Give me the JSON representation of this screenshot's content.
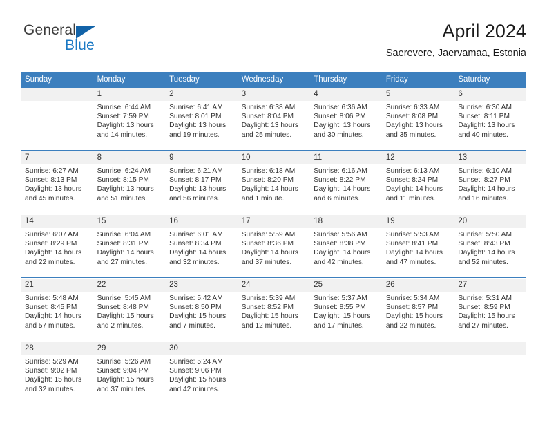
{
  "brand": {
    "name_part1": "General",
    "name_part2": "Blue",
    "accent_color": "#1b79c4",
    "triangle_color": "#1263a8"
  },
  "header": {
    "title": "April 2024",
    "subtitle": "Saerevere, Jaervamaa, Estonia"
  },
  "theme": {
    "header_row_bg": "#3c7fbe",
    "daynum_bg": "#f1f1f1",
    "separator_color": "#3c7fbe",
    "text_color": "#333333"
  },
  "weekdays": [
    "Sunday",
    "Monday",
    "Tuesday",
    "Wednesday",
    "Thursday",
    "Friday",
    "Saturday"
  ],
  "weeks": [
    {
      "days": [
        {
          "num": "",
          "sunrise": "",
          "sunset": "",
          "daylight": ""
        },
        {
          "num": "1",
          "sunrise": "Sunrise: 6:44 AM",
          "sunset": "Sunset: 7:59 PM",
          "daylight": "Daylight: 13 hours and 14 minutes."
        },
        {
          "num": "2",
          "sunrise": "Sunrise: 6:41 AM",
          "sunset": "Sunset: 8:01 PM",
          "daylight": "Daylight: 13 hours and 19 minutes."
        },
        {
          "num": "3",
          "sunrise": "Sunrise: 6:38 AM",
          "sunset": "Sunset: 8:04 PM",
          "daylight": "Daylight: 13 hours and 25 minutes."
        },
        {
          "num": "4",
          "sunrise": "Sunrise: 6:36 AM",
          "sunset": "Sunset: 8:06 PM",
          "daylight": "Daylight: 13 hours and 30 minutes."
        },
        {
          "num": "5",
          "sunrise": "Sunrise: 6:33 AM",
          "sunset": "Sunset: 8:08 PM",
          "daylight": "Daylight: 13 hours and 35 minutes."
        },
        {
          "num": "6",
          "sunrise": "Sunrise: 6:30 AM",
          "sunset": "Sunset: 8:11 PM",
          "daylight": "Daylight: 13 hours and 40 minutes."
        }
      ]
    },
    {
      "days": [
        {
          "num": "7",
          "sunrise": "Sunrise: 6:27 AM",
          "sunset": "Sunset: 8:13 PM",
          "daylight": "Daylight: 13 hours and 45 minutes."
        },
        {
          "num": "8",
          "sunrise": "Sunrise: 6:24 AM",
          "sunset": "Sunset: 8:15 PM",
          "daylight": "Daylight: 13 hours and 51 minutes."
        },
        {
          "num": "9",
          "sunrise": "Sunrise: 6:21 AM",
          "sunset": "Sunset: 8:17 PM",
          "daylight": "Daylight: 13 hours and 56 minutes."
        },
        {
          "num": "10",
          "sunrise": "Sunrise: 6:18 AM",
          "sunset": "Sunset: 8:20 PM",
          "daylight": "Daylight: 14 hours and 1 minute."
        },
        {
          "num": "11",
          "sunrise": "Sunrise: 6:16 AM",
          "sunset": "Sunset: 8:22 PM",
          "daylight": "Daylight: 14 hours and 6 minutes."
        },
        {
          "num": "12",
          "sunrise": "Sunrise: 6:13 AM",
          "sunset": "Sunset: 8:24 PM",
          "daylight": "Daylight: 14 hours and 11 minutes."
        },
        {
          "num": "13",
          "sunrise": "Sunrise: 6:10 AM",
          "sunset": "Sunset: 8:27 PM",
          "daylight": "Daylight: 14 hours and 16 minutes."
        }
      ]
    },
    {
      "days": [
        {
          "num": "14",
          "sunrise": "Sunrise: 6:07 AM",
          "sunset": "Sunset: 8:29 PM",
          "daylight": "Daylight: 14 hours and 22 minutes."
        },
        {
          "num": "15",
          "sunrise": "Sunrise: 6:04 AM",
          "sunset": "Sunset: 8:31 PM",
          "daylight": "Daylight: 14 hours and 27 minutes."
        },
        {
          "num": "16",
          "sunrise": "Sunrise: 6:01 AM",
          "sunset": "Sunset: 8:34 PM",
          "daylight": "Daylight: 14 hours and 32 minutes."
        },
        {
          "num": "17",
          "sunrise": "Sunrise: 5:59 AM",
          "sunset": "Sunset: 8:36 PM",
          "daylight": "Daylight: 14 hours and 37 minutes."
        },
        {
          "num": "18",
          "sunrise": "Sunrise: 5:56 AM",
          "sunset": "Sunset: 8:38 PM",
          "daylight": "Daylight: 14 hours and 42 minutes."
        },
        {
          "num": "19",
          "sunrise": "Sunrise: 5:53 AM",
          "sunset": "Sunset: 8:41 PM",
          "daylight": "Daylight: 14 hours and 47 minutes."
        },
        {
          "num": "20",
          "sunrise": "Sunrise: 5:50 AM",
          "sunset": "Sunset: 8:43 PM",
          "daylight": "Daylight: 14 hours and 52 minutes."
        }
      ]
    },
    {
      "days": [
        {
          "num": "21",
          "sunrise": "Sunrise: 5:48 AM",
          "sunset": "Sunset: 8:45 PM",
          "daylight": "Daylight: 14 hours and 57 minutes."
        },
        {
          "num": "22",
          "sunrise": "Sunrise: 5:45 AM",
          "sunset": "Sunset: 8:48 PM",
          "daylight": "Daylight: 15 hours and 2 minutes."
        },
        {
          "num": "23",
          "sunrise": "Sunrise: 5:42 AM",
          "sunset": "Sunset: 8:50 PM",
          "daylight": "Daylight: 15 hours and 7 minutes."
        },
        {
          "num": "24",
          "sunrise": "Sunrise: 5:39 AM",
          "sunset": "Sunset: 8:52 PM",
          "daylight": "Daylight: 15 hours and 12 minutes."
        },
        {
          "num": "25",
          "sunrise": "Sunrise: 5:37 AM",
          "sunset": "Sunset: 8:55 PM",
          "daylight": "Daylight: 15 hours and 17 minutes."
        },
        {
          "num": "26",
          "sunrise": "Sunrise: 5:34 AM",
          "sunset": "Sunset: 8:57 PM",
          "daylight": "Daylight: 15 hours and 22 minutes."
        },
        {
          "num": "27",
          "sunrise": "Sunrise: 5:31 AM",
          "sunset": "Sunset: 8:59 PM",
          "daylight": "Daylight: 15 hours and 27 minutes."
        }
      ]
    },
    {
      "days": [
        {
          "num": "28",
          "sunrise": "Sunrise: 5:29 AM",
          "sunset": "Sunset: 9:02 PM",
          "daylight": "Daylight: 15 hours and 32 minutes."
        },
        {
          "num": "29",
          "sunrise": "Sunrise: 5:26 AM",
          "sunset": "Sunset: 9:04 PM",
          "daylight": "Daylight: 15 hours and 37 minutes."
        },
        {
          "num": "30",
          "sunrise": "Sunrise: 5:24 AM",
          "sunset": "Sunset: 9:06 PM",
          "daylight": "Daylight: 15 hours and 42 minutes."
        },
        {
          "num": "",
          "sunrise": "",
          "sunset": "",
          "daylight": ""
        },
        {
          "num": "",
          "sunrise": "",
          "sunset": "",
          "daylight": ""
        },
        {
          "num": "",
          "sunrise": "",
          "sunset": "",
          "daylight": ""
        },
        {
          "num": "",
          "sunrise": "",
          "sunset": "",
          "daylight": ""
        }
      ]
    }
  ]
}
